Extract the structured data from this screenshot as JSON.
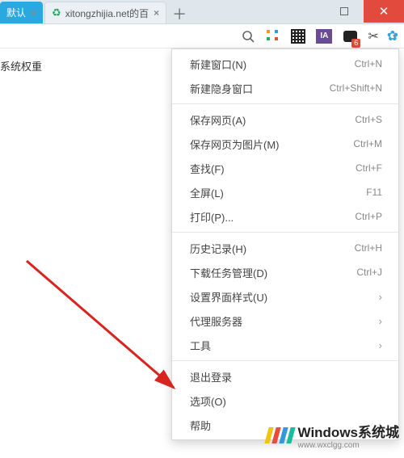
{
  "tabs": {
    "activeLabel": "默认",
    "inactiveLabel": "xitongzhijia.net的百",
    "closeGlyph": "×",
    "addGlyph": "＋"
  },
  "winControls": {
    "closeGlyph": "✕"
  },
  "toolbar": {
    "gridColors": [
      "#f39c12",
      "#3498db",
      "#27ae60",
      "#e74c3c"
    ],
    "iaLabel": "IA",
    "msgBadge": "6",
    "scissorsGlyph": "✂",
    "chevGlyph": "▾",
    "gearGlyph": "✿"
  },
  "page": {
    "leftText": "系统权重"
  },
  "menu": [
    {
      "type": "item",
      "label": "新建窗口(N)",
      "shortcut": "Ctrl+N"
    },
    {
      "type": "item",
      "label": "新建隐身窗口",
      "shortcut": "Ctrl+Shift+N"
    },
    {
      "type": "sep"
    },
    {
      "type": "item",
      "label": "保存网页(A)",
      "shortcut": "Ctrl+S"
    },
    {
      "type": "item",
      "label": "保存网页为图片(M)",
      "shortcut": "Ctrl+M"
    },
    {
      "type": "item",
      "label": "查找(F)",
      "shortcut": "Ctrl+F"
    },
    {
      "type": "item",
      "label": "全屏(L)",
      "shortcut": "F11"
    },
    {
      "type": "item",
      "label": "打印(P)...",
      "shortcut": "Ctrl+P"
    },
    {
      "type": "sep"
    },
    {
      "type": "item",
      "label": "历史记录(H)",
      "shortcut": "Ctrl+H"
    },
    {
      "type": "item",
      "label": "下载任务管理(D)",
      "shortcut": "Ctrl+J"
    },
    {
      "type": "item",
      "label": "设置界面样式(U)",
      "submenu": true
    },
    {
      "type": "item",
      "label": "代理服务器",
      "submenu": true
    },
    {
      "type": "item",
      "label": "工具",
      "submenu": true
    },
    {
      "type": "sep"
    },
    {
      "type": "item",
      "label": "退出登录"
    },
    {
      "type": "item",
      "label": "选项(O)"
    },
    {
      "type": "item",
      "label": "帮助",
      "submenu": true
    }
  ],
  "watermark": {
    "barColors": [
      "#f1c40f",
      "#e74c3c",
      "#3498db",
      "#1abc9c"
    ],
    "title": "Windows系统城",
    "sub": "www.wxclgg.com"
  }
}
